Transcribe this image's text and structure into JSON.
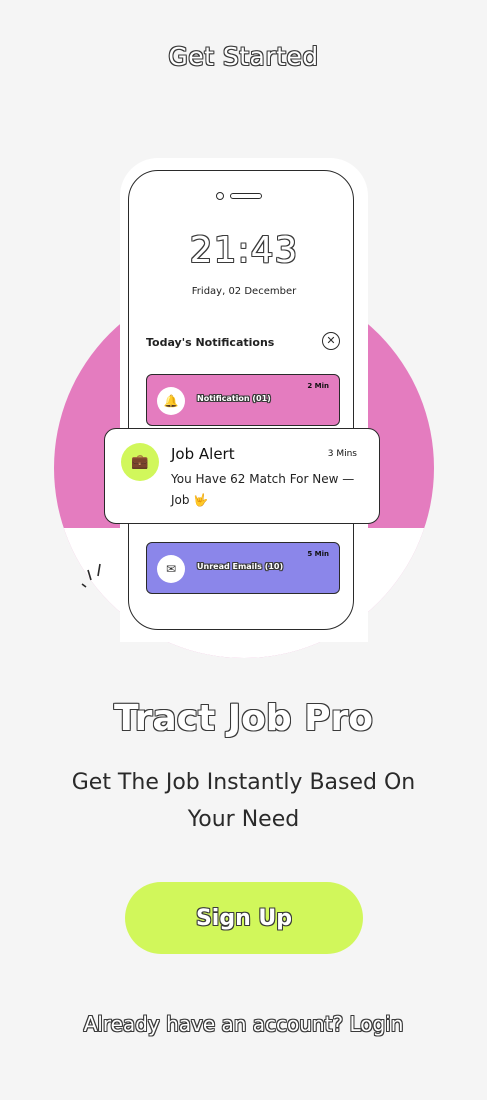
{
  "header": {
    "title": "Get Started"
  },
  "phone": {
    "clock": "21:43",
    "date": "Friday, 02 December",
    "notifications_heading": "Today's Notifications",
    "close_icon": "close-icon",
    "cards": [
      {
        "label": "Notification (01)",
        "time": "2 Min",
        "icon": "bell-icon",
        "color": "#e47cbf"
      },
      {
        "label": "Unread Emails (10)",
        "time": "5 Min",
        "icon": "envelope-icon",
        "color": "#8b86ea"
      }
    ]
  },
  "job_alert": {
    "title": "Job Alert",
    "time": "3 Mins",
    "description": "You Have 62 Match For New — Job 🤟",
    "icon": "briefcase-icon",
    "icon_color": "#d1f75b"
  },
  "main": {
    "title": "Tract Job Pro",
    "subtitle": "Get The Job Instantly Based On Your Need"
  },
  "actions": {
    "signup_label": "Sign Up",
    "signup_color": "#d1f75b",
    "login_prompt": "Already have an account?",
    "login_label": "Login"
  },
  "colors": {
    "accent_pink": "#e47cbf",
    "accent_purple": "#8b86ea",
    "accent_lime": "#d1f75b"
  }
}
